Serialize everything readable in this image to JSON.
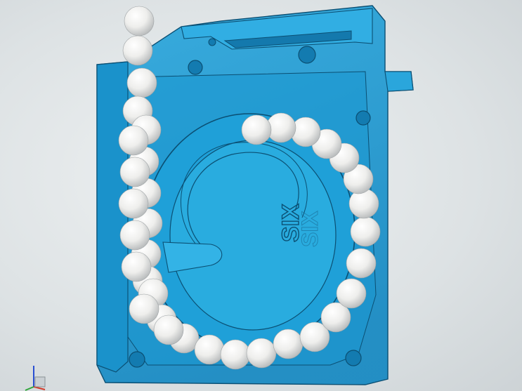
{
  "viewport": {
    "background": "#dfe4e6",
    "part_color": "#1e9bd4",
    "part_edge_color": "#0b4f73",
    "ball_color": "#f4f4f2"
  },
  "model": {
    "engraved_text": "SIX"
  },
  "triad": {
    "x_color": "#d23a2a",
    "y_color": "#2fa53a",
    "z_color": "#2a4fd2"
  }
}
